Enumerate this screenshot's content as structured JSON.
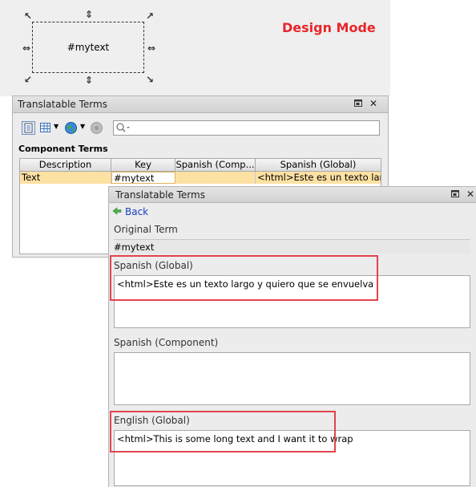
{
  "design": {
    "mode_label": "Design Mode",
    "component_text": "#mytext"
  },
  "panel1": {
    "title": "Translatable Terms",
    "search": {
      "placeholder": "",
      "value": ""
    },
    "section_label": "Component Terms",
    "columns": [
      "Description",
      "Key",
      "Spanish (Comp...",
      "Spanish (Global)"
    ],
    "rows": [
      [
        "Text",
        "#mytext",
        "",
        "<html>Este es un texto lar..."
      ]
    ]
  },
  "panel2": {
    "title": "Translatable Terms",
    "back_label": "Back",
    "original_term_label": "Original Term",
    "original_term_value": "#mytext",
    "spanish_global_label": "Spanish (Global)",
    "spanish_global_value": "<html>Este es un texto largo y quiero que se envuelva",
    "spanish_component_label": "Spanish (Component)",
    "spanish_component_value": "",
    "english_global_label": "English (Global)",
    "english_global_value": "<html>This is some long text and I want it to wrap"
  },
  "colors": {
    "design_mode": "#e8262b",
    "highlight": "#e0454d",
    "selected_row": "#fde1a3",
    "link": "#1a3fbf"
  }
}
